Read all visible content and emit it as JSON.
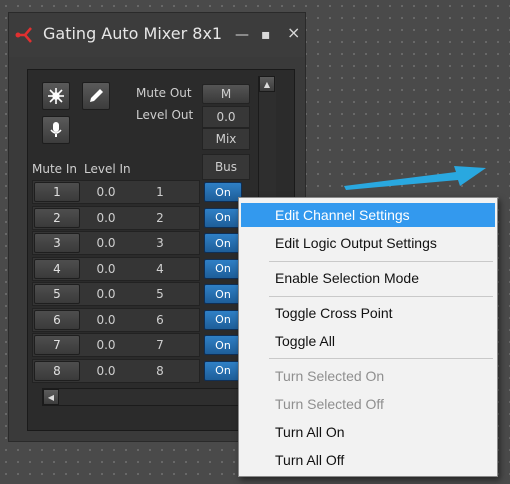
{
  "window": {
    "title": "Gating Auto Mixer 8x1",
    "minimize_glyph": "—",
    "maximize_glyph": "▪",
    "close_glyph": "×",
    "logo_icon": "signal-flow-logo-icon"
  },
  "toolbar": {
    "icons": [
      "snowflake-icon",
      "pencil-icon",
      "microphone-icon"
    ]
  },
  "output": {
    "mute_label": "Mute Out",
    "level_label": "Level Out",
    "mute_value": "M",
    "level_value": "0.0",
    "mix_label": "Mix",
    "bus_label": "Bus"
  },
  "input": {
    "mute_label": "Mute In",
    "level_label": "Level In"
  },
  "channels": [
    {
      "num": "1",
      "level": "0.0",
      "label": "1",
      "cross": "On"
    },
    {
      "num": "2",
      "level": "0.0",
      "label": "2",
      "cross": "On"
    },
    {
      "num": "3",
      "level": "0.0",
      "label": "3",
      "cross": "On"
    },
    {
      "num": "4",
      "level": "0.0",
      "label": "4",
      "cross": "On"
    },
    {
      "num": "5",
      "level": "0.0",
      "label": "5",
      "cross": "On"
    },
    {
      "num": "6",
      "level": "0.0",
      "label": "6",
      "cross": "On"
    },
    {
      "num": "7",
      "level": "0.0",
      "label": "7",
      "cross": "On"
    },
    {
      "num": "8",
      "level": "0.0",
      "label": "8",
      "cross": "On"
    }
  ],
  "context_menu": {
    "items": [
      {
        "label": "Edit Channel Settings",
        "enabled": true,
        "highlighted": true
      },
      {
        "label": "Edit Logic Output Settings",
        "enabled": true
      },
      {
        "label": "Enable Selection Mode",
        "enabled": true
      },
      {
        "label": "Toggle Cross Point",
        "enabled": true
      },
      {
        "label": "Toggle All",
        "enabled": true
      },
      {
        "label": "Turn Selected On",
        "enabled": false
      },
      {
        "label": "Turn Selected Off",
        "enabled": false
      },
      {
        "label": "Turn All On",
        "enabled": true
      },
      {
        "label": "Turn All Off",
        "enabled": true
      }
    ]
  },
  "colors": {
    "accent_blue": "#1e6eb8",
    "menu_highlight": "#3399ee",
    "arrow": "#29a8e0",
    "logo_red": "#e03030"
  }
}
